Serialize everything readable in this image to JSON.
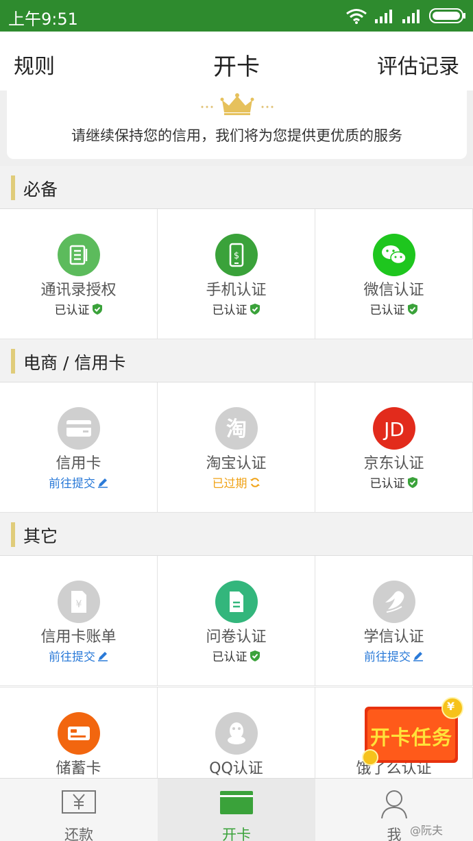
{
  "status_bar": {
    "time": "上午9:51"
  },
  "navbar": {
    "left": "规则",
    "title": "开卡",
    "right": "评估记录"
  },
  "banner": {
    "text": "请继续保持您的信用，我们将为您提供更优质的服务"
  },
  "sections": [
    {
      "title": "必备",
      "items": [
        {
          "name": "通讯录授权",
          "status": "已认证",
          "status_type": "verified",
          "icon": "contacts-icon",
          "icon_color": "#5cbb5c"
        },
        {
          "name": "手机认证",
          "status": "已认证",
          "status_type": "verified",
          "icon": "phone-icon",
          "icon_color": "#3aa23a"
        },
        {
          "name": "微信认证",
          "status": "已认证",
          "status_type": "verified",
          "icon": "wechat-icon",
          "icon_color": "#1ec61e"
        }
      ]
    },
    {
      "title": "电商 / 信用卡",
      "items": [
        {
          "name": "信用卡",
          "status": "前往提交",
          "status_type": "submit",
          "icon": "credit-card-icon",
          "icon_color": "#cfcfcf"
        },
        {
          "name": "淘宝认证",
          "status": "已过期",
          "status_type": "expired",
          "icon": "taobao-icon",
          "icon_color": "#cfcfcf"
        },
        {
          "name": "京东认证",
          "status": "已认证",
          "status_type": "verified",
          "icon": "jd-icon",
          "icon_color": "#e22b1c"
        }
      ]
    },
    {
      "title": "其它",
      "items": [
        {
          "name": "信用卡账单",
          "status": "前往提交",
          "status_type": "submit",
          "icon": "bill-icon",
          "icon_color": "#cfcfcf"
        },
        {
          "name": "问卷认证",
          "status": "已认证",
          "status_type": "verified",
          "icon": "questionnaire-icon",
          "icon_color": "#33b67c"
        },
        {
          "name": "学信认证",
          "status": "前往提交",
          "status_type": "submit",
          "icon": "chsi-icon",
          "icon_color": "#cfcfcf"
        },
        {
          "name": "储蓄卡",
          "status": "",
          "status_type": "",
          "icon": "debit-card-icon",
          "icon_color": "#f2660f"
        },
        {
          "name": "QQ认证",
          "status": "",
          "status_type": "",
          "icon": "qq-icon",
          "icon_color": "#cfcfcf"
        },
        {
          "name": "饿了么认证",
          "status": "",
          "status_type": "",
          "icon": "eleme-icon",
          "icon_color": "#cfcfcf"
        }
      ]
    }
  ],
  "promo": {
    "label": "开卡任务",
    "coin": "¥"
  },
  "tabbar": [
    {
      "label": "还款",
      "icon": "repay-icon",
      "active": false
    },
    {
      "label": "开卡",
      "icon": "card-icon",
      "active": true
    },
    {
      "label": "我",
      "icon": "user-icon",
      "active": false
    }
  ],
  "watermark": "@阮夫",
  "colors": {
    "brand": "#2e8b2e",
    "accent_bar": "#e0cc7a",
    "verified": "#3aa23a",
    "submit": "#2a7ad8",
    "expired": "#f0a318"
  }
}
